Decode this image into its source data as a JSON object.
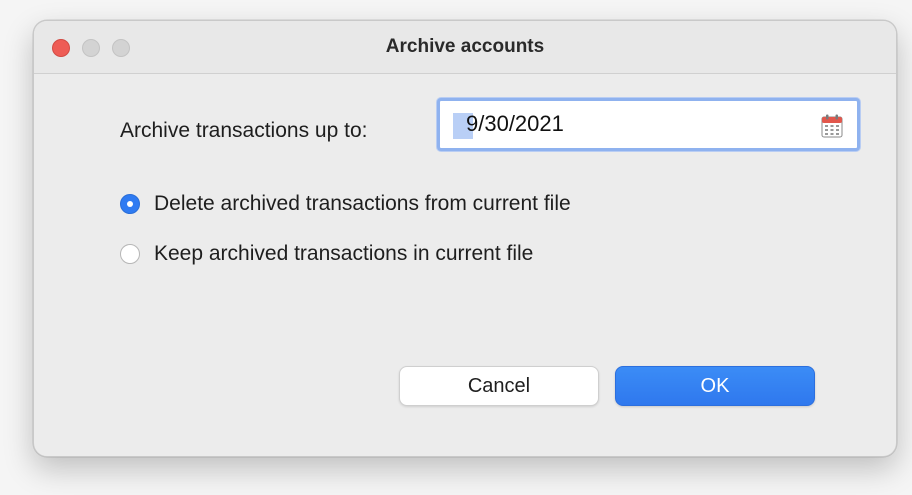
{
  "window": {
    "title": "Archive accounts"
  },
  "form": {
    "archive_label": "Archive transactions up to:",
    "date_value": "9/30/2021",
    "options": [
      {
        "label": "Delete archived transactions from current file",
        "selected": true
      },
      {
        "label": "Keep archived transactions in current file",
        "selected": false
      }
    ]
  },
  "buttons": {
    "cancel_label": "Cancel",
    "ok_label": "OK"
  },
  "icons": {
    "traffic_close": "close-icon",
    "traffic_minimize": "minimize-icon",
    "traffic_maximize": "zoom-icon",
    "date_picker": "calendar-icon"
  },
  "colors": {
    "accent": "#2f7bf2",
    "close_light": "#ee5c55",
    "focus_ring": "#8fb2ef"
  }
}
